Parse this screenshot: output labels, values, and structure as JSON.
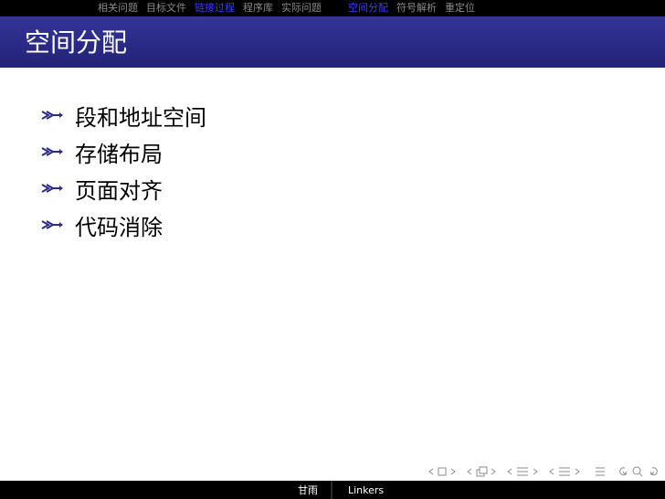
{
  "header": {
    "sections_left": [
      {
        "label": "相关问题",
        "active": false
      },
      {
        "label": "目标文件",
        "active": false
      },
      {
        "label": "链接过程",
        "active": true
      },
      {
        "label": "程序库",
        "active": false
      },
      {
        "label": "实际问题",
        "active": false
      }
    ],
    "sections_right": [
      {
        "label": "空间分配",
        "active": true
      },
      {
        "label": "符号解析",
        "active": false
      },
      {
        "label": "重定位",
        "active": false
      }
    ]
  },
  "slide": {
    "title": "空间分配",
    "items": [
      {
        "text": "段和地址空间"
      },
      {
        "text": "存储布局"
      },
      {
        "text": "页面对齐"
      },
      {
        "text": "代码消除"
      }
    ]
  },
  "footer": {
    "author": "甘雨",
    "short_title": "Linkers"
  },
  "colors": {
    "title_bar": "#2b2b88",
    "active_nav": "#3b3bff",
    "inactive_nav": "#8a8a8a",
    "bullet": "#2b2b88"
  },
  "nav_icons": [
    "prev-frame-icon",
    "frame-icon",
    "next-frame-icon",
    "prev-subsection-icon",
    "subsection-icon",
    "next-subsection-icon",
    "prev-section-icon",
    "section-icon",
    "next-section-icon",
    "align-icon",
    "search-back-icon",
    "search-icon",
    "search-forward-icon"
  ]
}
